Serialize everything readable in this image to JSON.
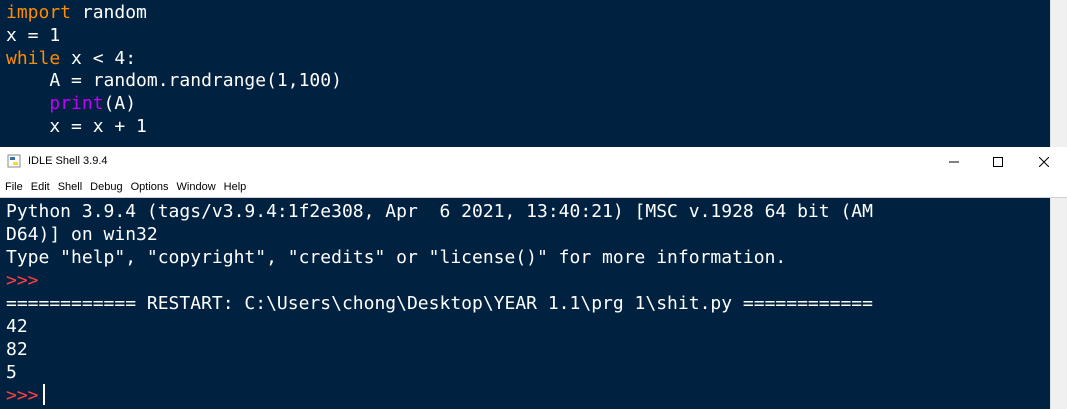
{
  "editor": {
    "lines": [
      {
        "keyword": "import",
        "rest": " random"
      },
      {
        "text": "x = 1"
      },
      {
        "keyword": "while",
        "rest": " x < 4:"
      },
      {
        "text": "    A = random.randrange(1,100)"
      },
      {
        "indent": "    ",
        "builtin": "print",
        "rest": "(A)"
      },
      {
        "text": "    x = x + 1"
      }
    ]
  },
  "window": {
    "title": "IDLE Shell 3.9.4",
    "minimize_icon": "minimize-icon",
    "maximize_icon": "maximize-icon",
    "close_icon": "close-icon"
  },
  "menu": [
    "File",
    "Edit",
    "Shell",
    "Debug",
    "Options",
    "Window",
    "Help"
  ],
  "shell": {
    "banner_line1": "Python 3.9.4 (tags/v3.9.4:1f2e308, Apr  6 2021, 13:40:21) [MSC v.1928 64 bit (AM",
    "banner_line2": "D64)] on win32",
    "banner_line3": "Type \"help\", \"copyright\", \"credits\" or \"license()\" for more information.",
    "prompt": ">>>",
    "restart_line": "============ RESTART: C:\\Users\\chong\\Desktop\\YEAR 1.1\\prg 1\\shit.py ============",
    "outputs": [
      "42",
      "82",
      "5"
    ]
  },
  "colors": {
    "background": "#002240",
    "keyword": "#ff8c00",
    "builtin": "#c000ff",
    "prompt": "#ff4040",
    "text": "#ffffff"
  }
}
